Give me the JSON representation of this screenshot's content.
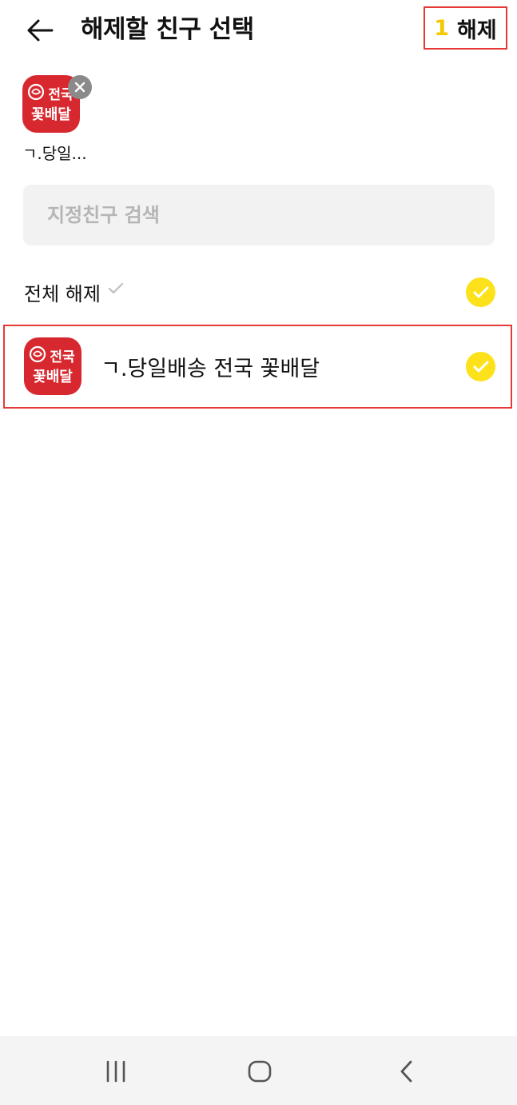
{
  "header": {
    "title": "해제할 친구 선택",
    "release_count": "1",
    "release_label": "해제"
  },
  "selected": {
    "name": "ㄱ.당일..."
  },
  "avatar": {
    "line1": "전국",
    "line2": "꽃배달",
    "bg_color": "#d8282f"
  },
  "search": {
    "placeholder": "지정친구 검색"
  },
  "select_all": {
    "label": "전체 해제"
  },
  "friends": [
    {
      "name": "ㄱ.당일배송 전국 꽃배달",
      "checked": true
    }
  ],
  "colors": {
    "accent_yellow": "#fde11a",
    "count_yellow": "#f5c800",
    "highlight_red": "#e53935"
  },
  "icons": {
    "back": "arrow-left-icon",
    "remove": "close-icon",
    "check": "check-icon",
    "nav_recents": "recent-apps-icon",
    "nav_home": "home-icon",
    "nav_back": "chevron-left-icon"
  }
}
